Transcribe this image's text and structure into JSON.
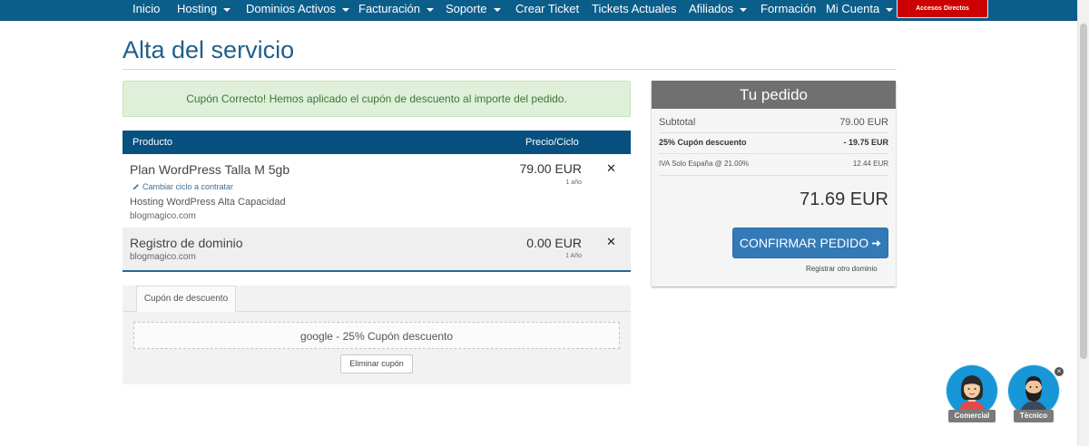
{
  "nav": {
    "items": [
      {
        "label": "Inicio",
        "dropdown": false
      },
      {
        "label": "Hosting",
        "dropdown": true
      },
      {
        "label": "Dominios Activos",
        "dropdown": true
      },
      {
        "label": "Facturación",
        "dropdown": true
      },
      {
        "label": "Soporte",
        "dropdown": true
      },
      {
        "label": "Crear Ticket",
        "dropdown": false
      },
      {
        "label": "Tickets Actuales",
        "dropdown": false
      },
      {
        "label": "Afiliados",
        "dropdown": true
      },
      {
        "label": "Formación",
        "dropdown": false
      },
      {
        "label": "Mi Cuenta",
        "dropdown": true
      }
    ],
    "accesos_label": "Accesos Directos",
    "colors": {
      "navbar": "#0b5e8a",
      "accesos": "#cc0000"
    }
  },
  "page": {
    "title": "Alta del servicio",
    "alert": "Cupón Correcto! Hemos aplicado el cupón de descuento al importe del pedido."
  },
  "cart": {
    "headers": {
      "product": "Producto",
      "price": "Precio/Ciclo"
    },
    "items": [
      {
        "name": "Plan WordPress Talla M 5gb",
        "change_cycle": "Cambiar ciclo a contratar",
        "description": "Hosting WordPress Alta Capacidad",
        "domain": "blogmagico.com",
        "price": "79.00 EUR",
        "cycle": "1 año",
        "remove_icon": "close-icon"
      },
      {
        "name": "Registro de dominio",
        "domain": "blogmagico.com",
        "price": "0.00 EUR",
        "cycle": "1 Año",
        "remove_icon": "close-icon"
      }
    ]
  },
  "coupon": {
    "tab_label": "Cupón de descuento",
    "applied": "google - 25% Cupón descuento",
    "remove_label": "Eliminar cupón"
  },
  "summary": {
    "title": "Tu pedido",
    "subtotal_label": "Subtotal",
    "subtotal_value": "79.00 EUR",
    "discount_label": "25% Cupón descuento",
    "discount_value": "- 19.75 EUR",
    "tax_label": "IVA Solo España @ 21.00%",
    "tax_value": "12.44 EUR",
    "total": "71.69 EUR",
    "confirm_label": "CONFIRMAR PEDIDO",
    "register_other": "Registrar otro dominio",
    "colors": {
      "header": "#707070",
      "confirm": "#337ab7"
    }
  },
  "chat": {
    "agents": [
      {
        "label": "Comercial",
        "icon": "woman-avatar-icon"
      },
      {
        "label": "Técnico",
        "icon": "bearded-man-avatar-icon"
      }
    ]
  }
}
